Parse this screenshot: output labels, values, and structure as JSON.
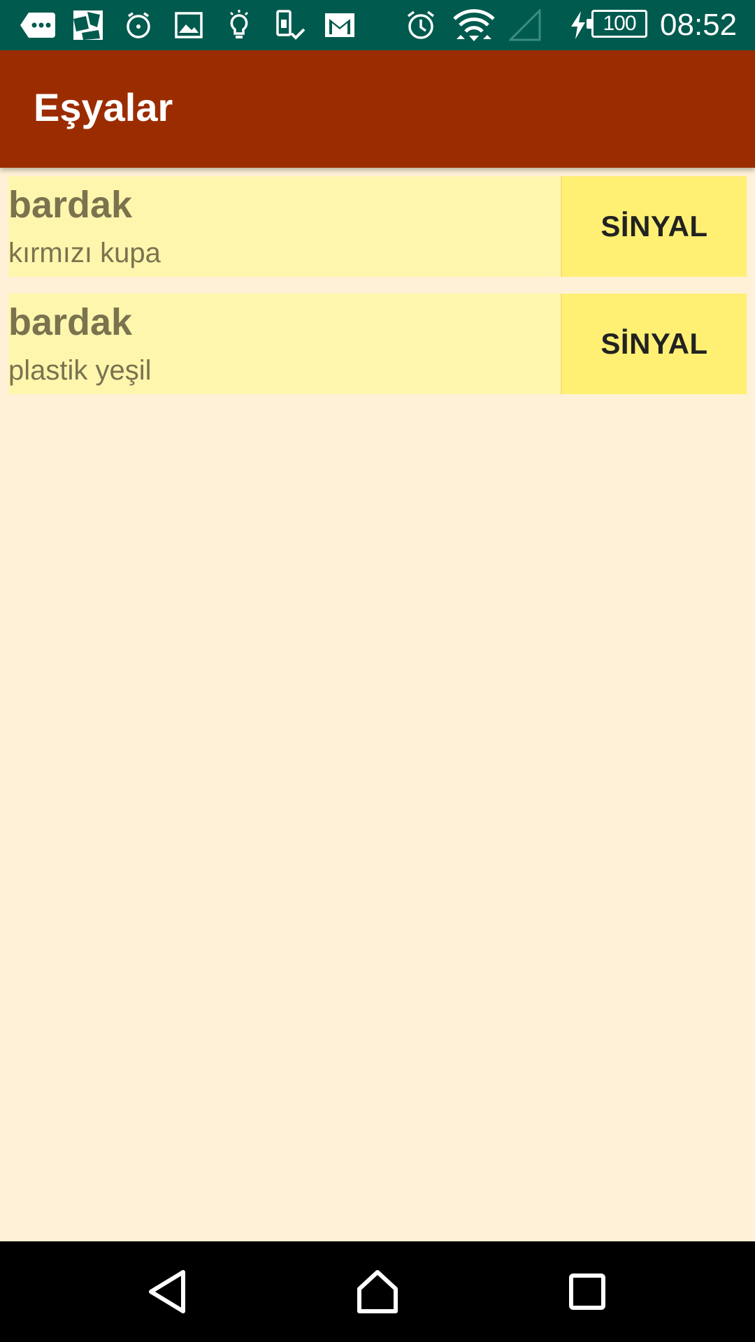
{
  "status_bar": {
    "time": "08:52",
    "battery_level": "100",
    "background_color": "#005A4E",
    "left_icons": [
      "chat-bubble-icon",
      "photo-collage-icon",
      "alarm-app-icon",
      "gallery-icon",
      "lightbulb-icon",
      "phone-check-icon",
      "gmail-icon"
    ],
    "right_icons": [
      "alarm-icon",
      "wifi-icon",
      "cell-signal-icon",
      "charging-icon",
      "battery-icon"
    ]
  },
  "app_bar": {
    "title": "Eşyalar",
    "background_color": "#9B2C00"
  },
  "items": [
    {
      "name": "bardak",
      "description": "kırmızı kupa",
      "action_label": "SİNYAL"
    },
    {
      "name": "bardak",
      "description": "plastik yeşil",
      "action_label": "SİNYAL"
    }
  ],
  "nav_bar": {
    "buttons": [
      "back-icon",
      "home-icon",
      "recents-icon"
    ]
  },
  "colors": {
    "page_background": "#FFF1D7",
    "row_background": "#FFF6AE",
    "button_background": "#FFF074",
    "item_text": "#7A734E"
  }
}
